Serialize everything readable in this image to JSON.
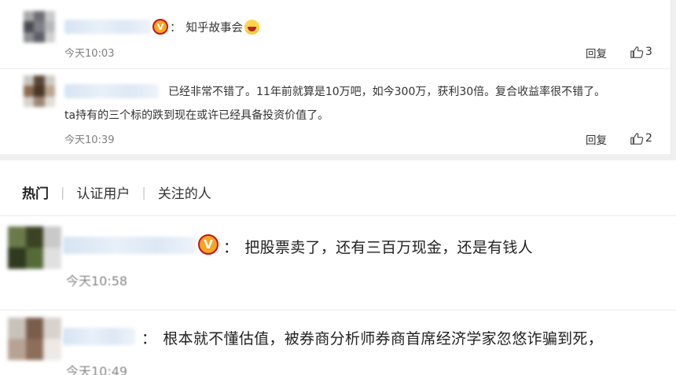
{
  "top_comments": [
    {
      "separator": "：",
      "text": "知乎故事会",
      "time": "今天10:03",
      "reply_label": "回复",
      "likes": "3"
    },
    {
      "text_line1": "已经非常不错了。11年前就算是10万吧，如今300万，获利30倍。复合收益率很不错了。",
      "text_line2": "ta持有的三个标的跌到现在或许已经具备投资价值了。",
      "time": "今天10:39",
      "reply_label": "回复",
      "likes": "2"
    }
  ],
  "tabs": [
    {
      "label": "热门",
      "active": true
    },
    {
      "label": "认证用户",
      "active": false
    },
    {
      "label": "关注的人",
      "active": false
    }
  ],
  "tab_separator": "|",
  "hot_comments": [
    {
      "separator": "：",
      "text": "把股票卖了，还有三百万现金，还是有钱人",
      "time": "今天10:58"
    },
    {
      "separator": "：",
      "text": "根本就不懂估值，被券商分析师券商首席经济学家忽悠诈骗到死，",
      "time": "今天10:49"
    }
  ],
  "icons": {
    "verified": "verified-v-badge-icon",
    "like": "thumbs-up-icon",
    "laugh": "laughing-emoji-icon"
  },
  "colors": {
    "badge_fill": "#f5a623",
    "badge_ring": "#c8111b",
    "time_text": "#808080"
  }
}
